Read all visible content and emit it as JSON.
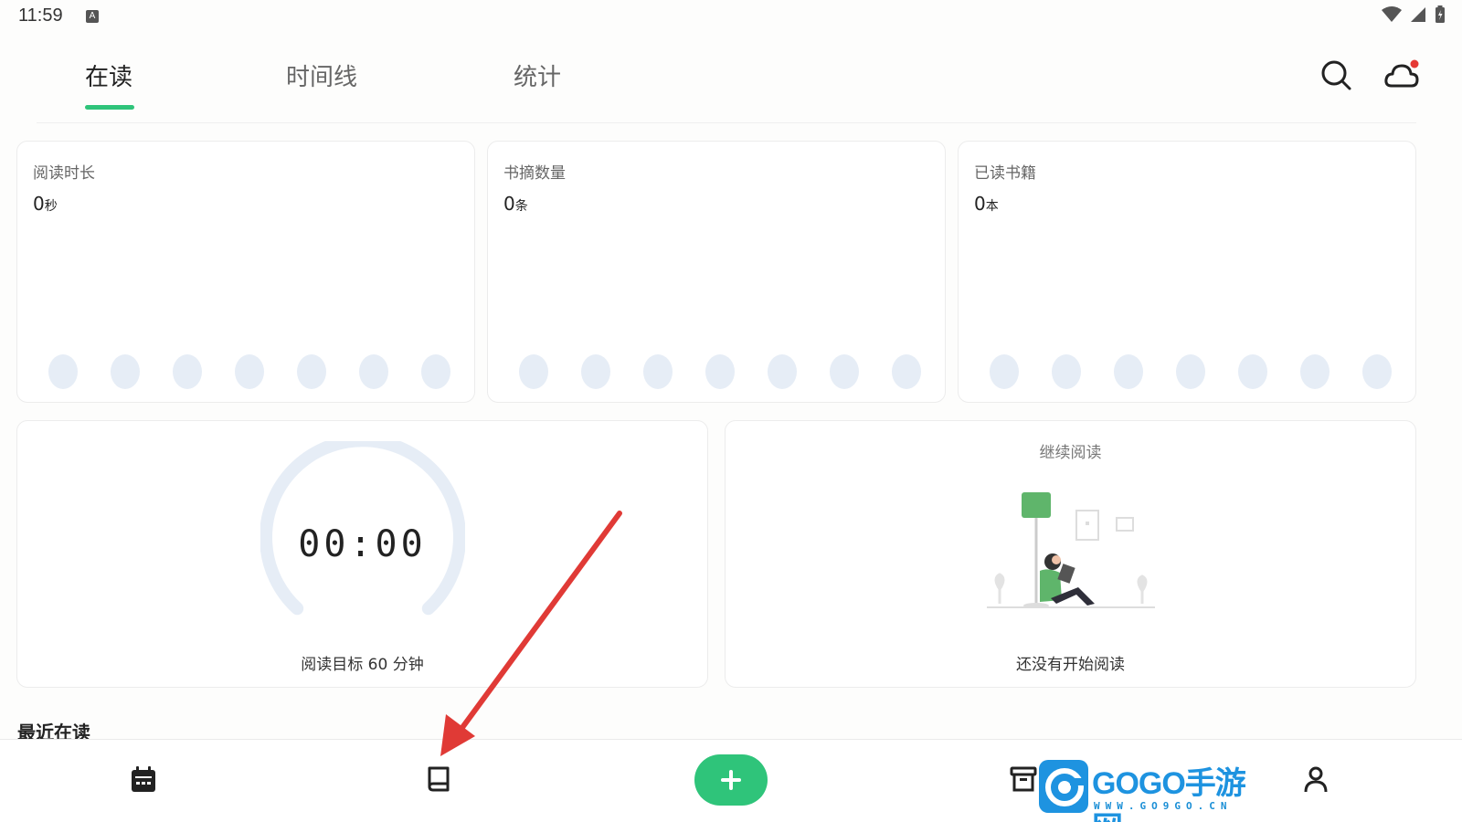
{
  "status": {
    "time": "11:59",
    "input_badge": "A"
  },
  "tabs": [
    {
      "label": "在读",
      "active": true
    },
    {
      "label": "时间线",
      "active": false
    },
    {
      "label": "统计",
      "active": false
    }
  ],
  "header_icons": [
    "search-icon",
    "cloud-sync-icon"
  ],
  "stats": [
    {
      "label": "阅读时长",
      "value": "0",
      "unit": "秒"
    },
    {
      "label": "书摘数量",
      "value": "0",
      "unit": "条"
    },
    {
      "label": "已读书籍",
      "value": "0",
      "unit": "本"
    }
  ],
  "timer": {
    "display": "00:00",
    "goal": "阅读目标 60 分钟"
  },
  "continue_reading": {
    "title": "继续阅读",
    "empty_text": "还没有开始阅读"
  },
  "recent": {
    "title": "最近在读"
  },
  "bottom_nav": [
    {
      "icon": "calendar-icon"
    },
    {
      "icon": "book-icon"
    },
    {
      "icon": "plus-icon"
    },
    {
      "icon": "archive-icon"
    },
    {
      "icon": "profile-icon"
    }
  ],
  "watermark": {
    "text": "GOGO手游网",
    "sub": "WWW.GO9GO.CN"
  },
  "colors": {
    "accent": "#2fc47a",
    "dot": "#e6edf6",
    "notification": "#e53935",
    "annotation_arrow": "#e03a36"
  }
}
